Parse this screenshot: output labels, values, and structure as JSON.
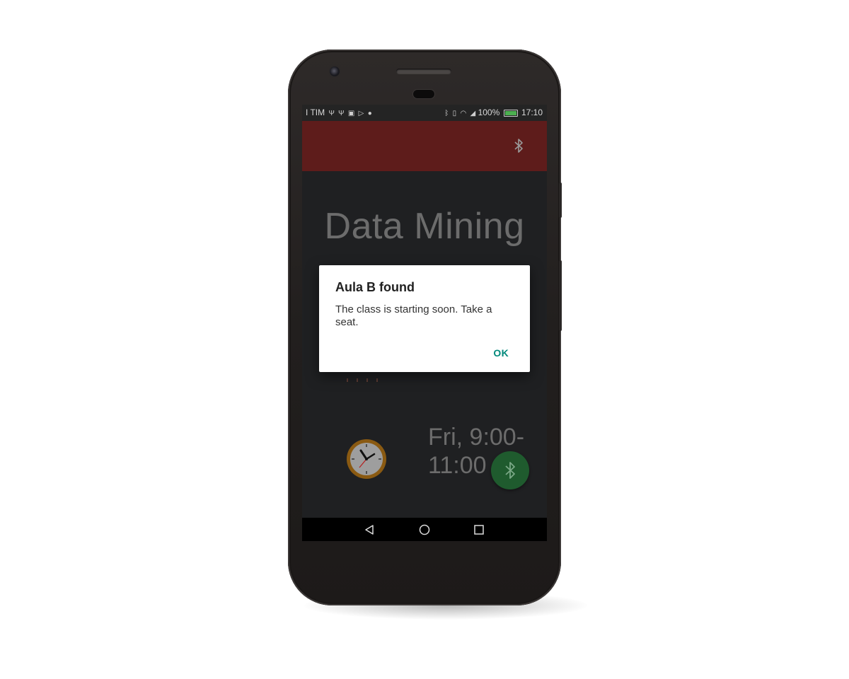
{
  "status_bar": {
    "carrier": "I TIM",
    "battery_percent": "100%",
    "time": "17:10"
  },
  "app_bar": {
    "action_icon": "bluetooth-icon",
    "color": "#5e1c1b"
  },
  "main": {
    "course_title": "Data Mining",
    "schedule": "Fri, 9:00-11:00",
    "clock_icon": "clock-icon",
    "fab_icon": "bluetooth-icon",
    "fab_color": "#1f5b2e"
  },
  "dialog": {
    "title": "Aula B found",
    "message": "The class is starting soon. Take a seat.",
    "ok_label": "OK",
    "accent": "#00897b"
  },
  "nav_bar": {
    "back_icon": "back-triangle-icon",
    "home_icon": "home-circle-icon",
    "recents_icon": "recents-square-icon"
  }
}
